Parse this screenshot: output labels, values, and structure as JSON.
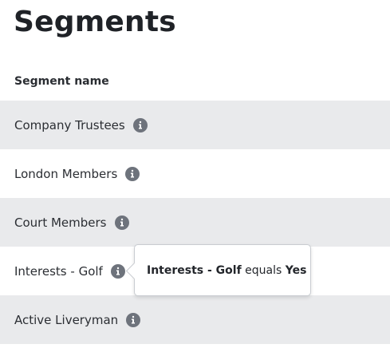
{
  "page": {
    "title": "Segments",
    "column_header": "Segment name"
  },
  "segments": [
    {
      "name": "Company Trustees",
      "info_icon": "info-icon"
    },
    {
      "name": "London Members",
      "info_icon": "info-icon"
    },
    {
      "name": "Court Members",
      "info_icon": "info-icon"
    },
    {
      "name": "Interests - Golf",
      "info_icon": "info-icon"
    },
    {
      "name": "Active Liveryman",
      "info_icon": "info-icon"
    }
  ],
  "tooltip": {
    "field": "Interests - Golf",
    "operator": "equals",
    "value": "Yes"
  },
  "colors": {
    "row_shade": "#e9eaec",
    "icon": "#6e737c",
    "text": "#23262b"
  }
}
